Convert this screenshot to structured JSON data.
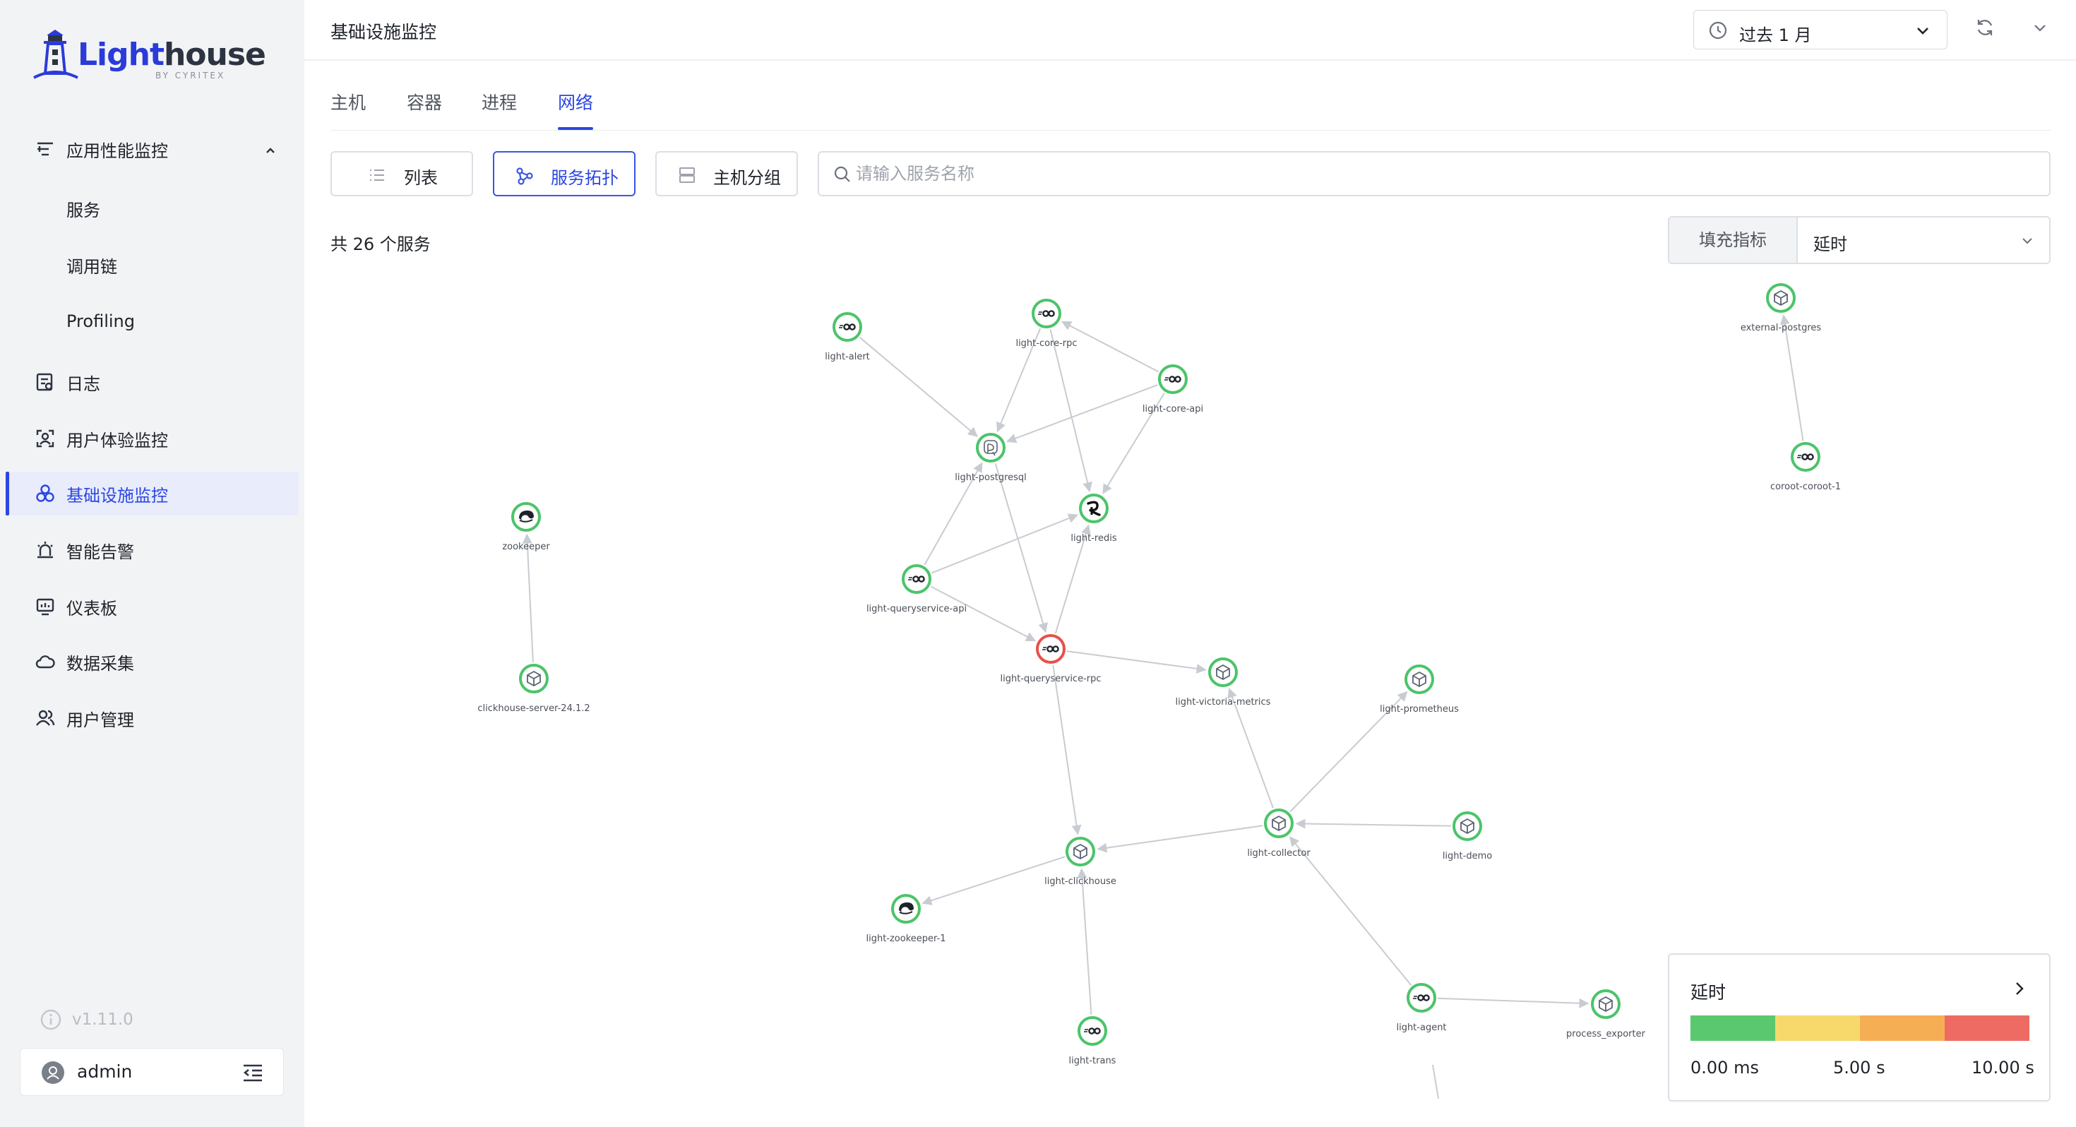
{
  "sidebar": {
    "logo": {
      "brand": "Lighthouse",
      "brand_light": "Light",
      "brand_dark": "house",
      "by": "by CYRITEX"
    },
    "nav": [
      {
        "id": "apm",
        "label": "应用性能监控",
        "icon": "sliders-icon",
        "expanded": true
      },
      {
        "id": "services",
        "label": "服务",
        "sub": true
      },
      {
        "id": "traces",
        "label": "调用链",
        "sub": true
      },
      {
        "id": "profiling",
        "label": "Profiling",
        "sub": true
      },
      {
        "id": "logs",
        "label": "日志",
        "icon": "log-icon"
      },
      {
        "id": "rum",
        "label": "用户体验监控",
        "icon": "user-scan-icon"
      },
      {
        "id": "infra",
        "label": "基础设施监控",
        "icon": "infra-icon",
        "active": true
      },
      {
        "id": "alerts",
        "label": "智能告警",
        "icon": "alarm-icon"
      },
      {
        "id": "dashboards",
        "label": "仪表板",
        "icon": "dashboard-icon"
      },
      {
        "id": "collect",
        "label": "数据采集",
        "icon": "cloud-collect-icon"
      },
      {
        "id": "users",
        "label": "用户管理",
        "icon": "users-icon"
      }
    ],
    "version": "v1.11.0",
    "user": "admin"
  },
  "header": {
    "title": "基础设施监控",
    "time_range": "过去 1 月"
  },
  "tabs": [
    {
      "label": "主机"
    },
    {
      "label": "容器"
    },
    {
      "label": "进程"
    },
    {
      "label": "网络",
      "active": true
    }
  ],
  "view_buttons": {
    "list": "列表",
    "topology": "服务拓扑",
    "host_group": "主机分组"
  },
  "search": {
    "placeholder": "请输入服务名称",
    "value": ""
  },
  "service_count": "共 26 个服务",
  "fill_metric": {
    "label": "填充指标",
    "value": "延时"
  },
  "legend": {
    "title": "延时",
    "ticks": [
      "0.00 ms",
      "5.00 s",
      "10.00 s"
    ],
    "colors": [
      "#5ac86e",
      "#f7d96b",
      "#f6ae54",
      "#ed6b62"
    ]
  },
  "colors": {
    "accent": "#2b47e0",
    "node_ok": "#4cc46a",
    "node_error": "#e8504a",
    "edge": "#c8ccd2"
  },
  "topology": {
    "nodes": [
      {
        "id": "light-alert",
        "label": "light-alert",
        "type": "go",
        "status": "ok"
      },
      {
        "id": "light-core-rpc",
        "label": "light-core-rpc",
        "type": "go",
        "status": "ok"
      },
      {
        "id": "light-core-api",
        "label": "light-core-api",
        "type": "go",
        "status": "ok"
      },
      {
        "id": "light-postgresql",
        "label": "light-postgresql",
        "type": "postgres",
        "status": "ok"
      },
      {
        "id": "light-redis",
        "label": "light-redis",
        "type": "redis",
        "status": "ok"
      },
      {
        "id": "light-queryservice-api",
        "label": "light-queryservice-api",
        "type": "go",
        "status": "ok"
      },
      {
        "id": "light-queryservice-rpc",
        "label": "light-queryservice-rpc",
        "type": "go",
        "status": "error"
      },
      {
        "id": "light-victoria-metrics",
        "label": "light-victoria-metrics",
        "type": "box",
        "status": "ok"
      },
      {
        "id": "light-prometheus",
        "label": "light-prometheus",
        "type": "box",
        "status": "ok"
      },
      {
        "id": "light-collector",
        "label": "light-collector",
        "type": "box",
        "status": "ok"
      },
      {
        "id": "light-demo",
        "label": "light-demo",
        "type": "box",
        "status": "ok"
      },
      {
        "id": "light-clickhouse",
        "label": "light-clickhouse",
        "type": "box",
        "status": "ok"
      },
      {
        "id": "light-zookeeper-1",
        "label": "light-zookeeper-1",
        "type": "zookeeper",
        "status": "ok"
      },
      {
        "id": "light-trans",
        "label": "light-trans",
        "type": "go",
        "status": "ok"
      },
      {
        "id": "light-agent",
        "label": "light-agent",
        "type": "go",
        "status": "ok"
      },
      {
        "id": "process_exporter",
        "label": "process_exporter",
        "type": "box",
        "status": "ok"
      },
      {
        "id": "zookeeper",
        "label": "zookeeper",
        "type": "zookeeper",
        "status": "ok"
      },
      {
        "id": "clickhouse-server-24.1.2",
        "label": "clickhouse-server-24.1.2",
        "type": "box",
        "status": "ok"
      },
      {
        "id": "external-postgres",
        "label": "external-postgres",
        "type": "box",
        "status": "ok"
      },
      {
        "id": "coroot-coroot-1",
        "label": "coroot-coroot-1",
        "type": "go",
        "status": "ok"
      }
    ],
    "edges": [
      [
        "light-alert",
        "light-postgresql"
      ],
      [
        "light-core-rpc",
        "light-postgresql"
      ],
      [
        "light-core-rpc",
        "light-redis"
      ],
      [
        "light-core-api",
        "light-core-rpc"
      ],
      [
        "light-core-api",
        "light-postgresql"
      ],
      [
        "light-core-api",
        "light-redis"
      ],
      [
        "light-queryservice-api",
        "light-postgresql"
      ],
      [
        "light-queryservice-api",
        "light-redis"
      ],
      [
        "light-queryservice-api",
        "light-queryservice-rpc"
      ],
      [
        "light-queryservice-rpc",
        "light-redis"
      ],
      [
        "light-postgresql",
        "light-queryservice-rpc"
      ],
      [
        "light-queryservice-rpc",
        "light-victoria-metrics"
      ],
      [
        "light-queryservice-rpc",
        "light-clickhouse"
      ],
      [
        "light-collector",
        "light-victoria-metrics"
      ],
      [
        "light-collector",
        "light-prometheus"
      ],
      [
        "light-collector",
        "light-clickhouse"
      ],
      [
        "light-demo",
        "light-collector"
      ],
      [
        "light-agent",
        "light-collector"
      ],
      [
        "light-agent",
        "process_exporter"
      ],
      [
        "light-clickhouse",
        "light-zookeeper-1"
      ],
      [
        "light-trans",
        "light-clickhouse"
      ],
      [
        "clickhouse-server-24.1.2",
        "zookeeper"
      ],
      [
        "coroot-coroot-1",
        "external-postgres"
      ]
    ]
  }
}
